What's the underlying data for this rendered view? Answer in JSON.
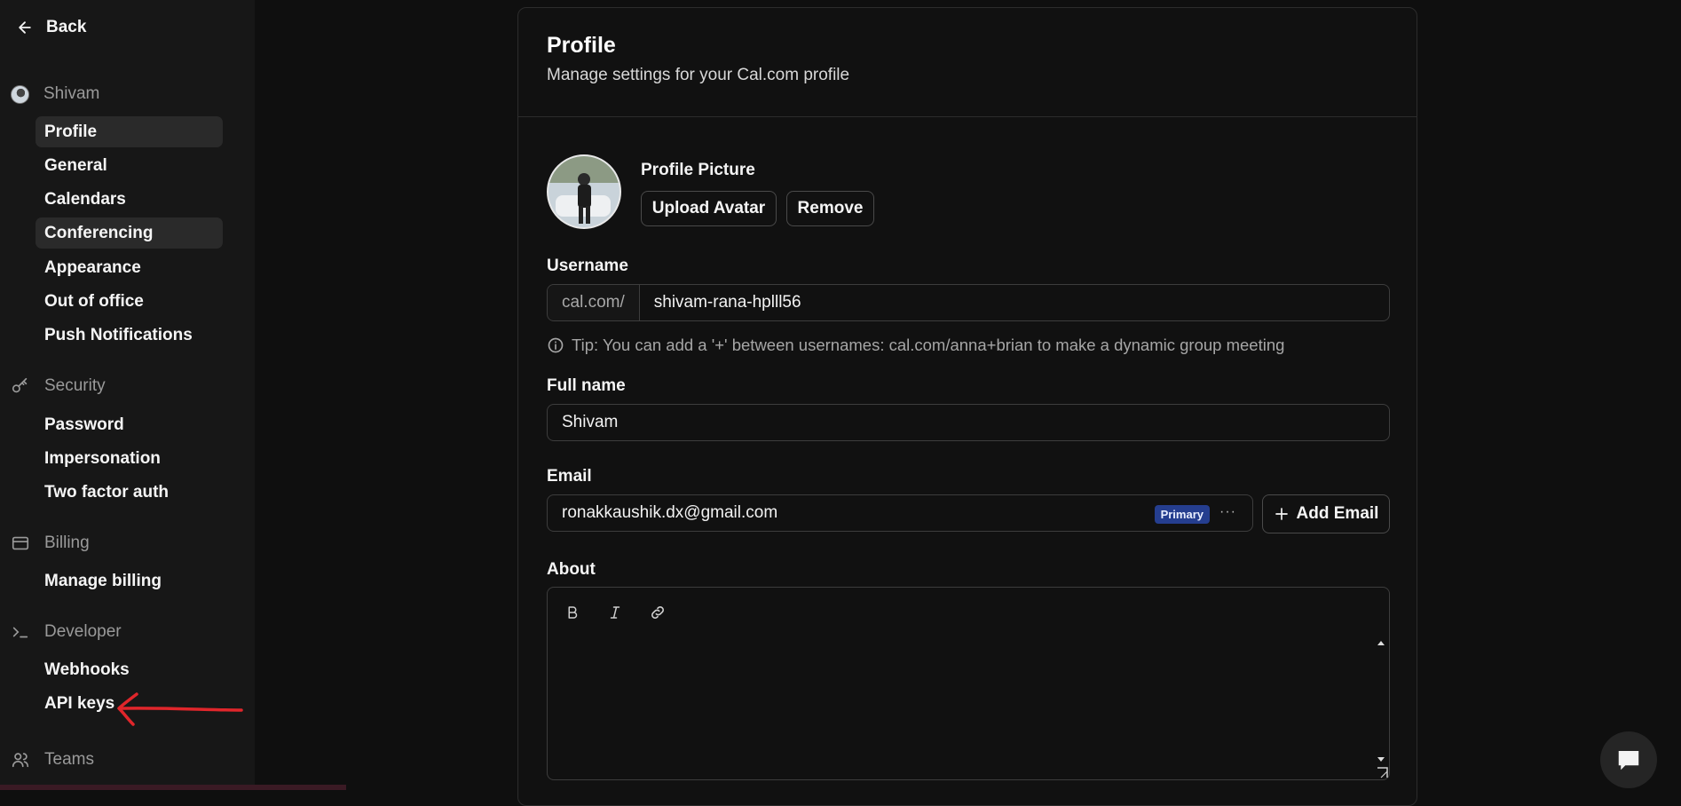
{
  "sidebar": {
    "back_label": "Back",
    "user_section": "Shivam",
    "user_items": [
      "Profile",
      "General",
      "Calendars",
      "Conferencing",
      "Appearance",
      "Out of office",
      "Push Notifications"
    ],
    "security_section": "Security",
    "security_items": [
      "Password",
      "Impersonation",
      "Two factor auth"
    ],
    "billing_section": "Billing",
    "billing_items": [
      "Manage billing"
    ],
    "developer_section": "Developer",
    "developer_items": [
      "Webhooks",
      "API keys"
    ],
    "teams_section": "Teams"
  },
  "profile": {
    "title": "Profile",
    "subtitle": "Manage settings for your Cal.com profile",
    "picture_label": "Profile Picture",
    "upload_label": "Upload Avatar",
    "remove_label": "Remove",
    "username_label": "Username",
    "username_prefix": "cal.com/",
    "username_value": "shivam-rana-hplll56",
    "tip": "Tip: You can add a '+' between usernames: cal.com/anna+brian to make a dynamic group meeting",
    "fullname_label": "Full name",
    "fullname_value": "Shivam",
    "email_label": "Email",
    "email_value": "ronakkaushik.dx@gmail.com",
    "email_badge": "Primary",
    "email_more": "···",
    "add_email_label": "Add Email",
    "about_label": "About"
  },
  "colors": {
    "accent_badge": "#253e8f",
    "annotation_arrow": "#e0262b"
  }
}
